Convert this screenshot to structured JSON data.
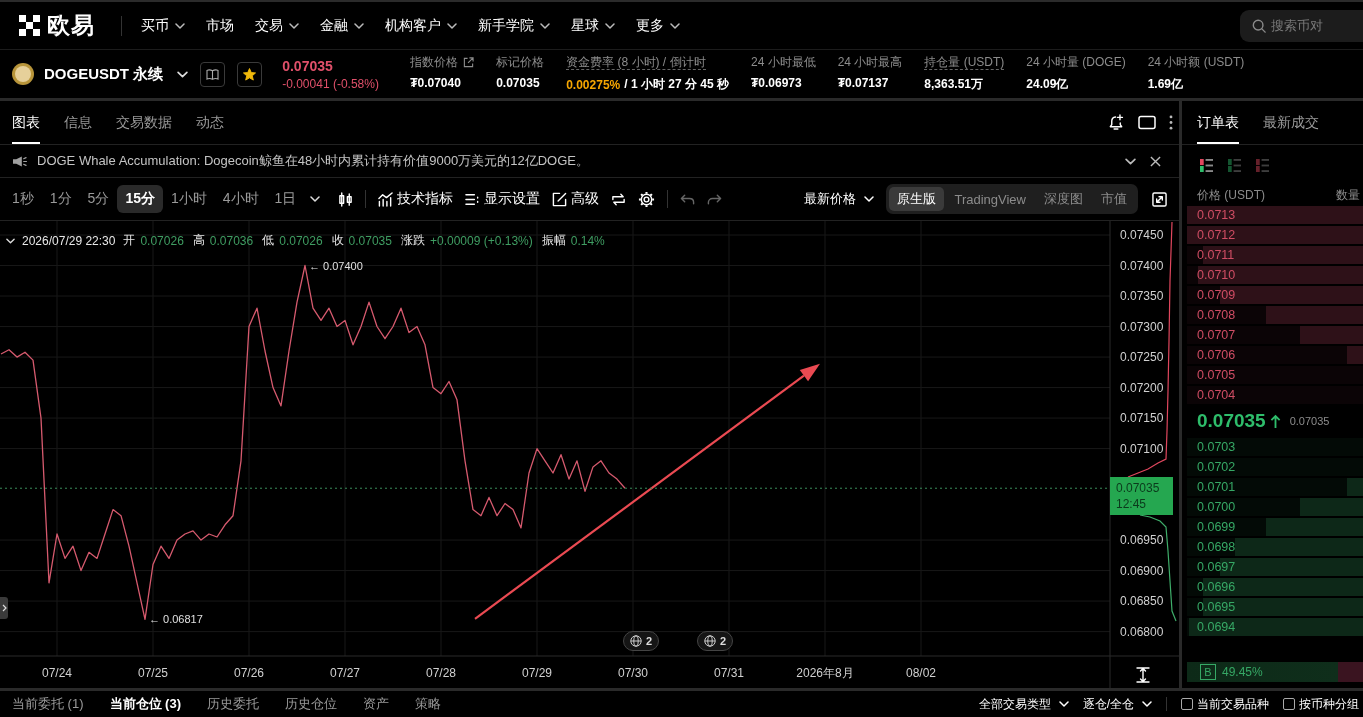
{
  "nav": {
    "logo": "欧易",
    "menu": [
      {
        "label": "买币",
        "dropdown": true
      },
      {
        "label": "市场",
        "dropdown": false
      },
      {
        "label": "交易",
        "dropdown": true
      },
      {
        "label": "金融",
        "dropdown": true
      },
      {
        "label": "机构客户",
        "dropdown": true
      },
      {
        "label": "新手学院",
        "dropdown": true
      },
      {
        "label": "星球",
        "dropdown": true
      },
      {
        "label": "更多",
        "dropdown": true
      }
    ],
    "search": {
      "placeholder": "搜索币对"
    }
  },
  "ticker": {
    "symbol": "DOGEUSDT 永续",
    "favorite": true,
    "price": "0.07035",
    "change": "-0.00041 (-0.58%)",
    "negative": true,
    "stats": [
      {
        "label": "指数价格",
        "kind": "link",
        "value": "₮0.07040"
      },
      {
        "label": "标记价格",
        "kind": "plain",
        "value": "0.07035"
      },
      {
        "label": "资金费率 (8 小时) / 倒计时",
        "kind": "dotted",
        "rate": "0.00275%",
        "value": "/ 1 小时 27 分 45 秒"
      },
      {
        "label": "24 小时最低",
        "kind": "plain",
        "value": "₮0.06973"
      },
      {
        "label": "24 小时最高",
        "kind": "plain",
        "value": "₮0.07137"
      },
      {
        "label": "持仓量 (USDT)",
        "kind": "dotted",
        "value": "8,363.51万"
      },
      {
        "label": "24 小时量 (DOGE)",
        "kind": "plain",
        "value": "24.09亿"
      },
      {
        "label": "24 小时额 (USDT)",
        "kind": "plain",
        "value": "1.69亿"
      }
    ]
  },
  "chart_panel": {
    "tabs": [
      {
        "label": "图表",
        "selected": true
      },
      {
        "label": "信息",
        "selected": false
      },
      {
        "label": "交易数据",
        "selected": false
      },
      {
        "label": "动态",
        "selected": false
      }
    ],
    "news": {
      "text": "DOGE Whale Accumulation: Dogecoin鲸鱼在48小时内累计持有价值9000万美元的12亿DOGE。"
    },
    "intervals": [
      {
        "label": "1秒",
        "selected": false
      },
      {
        "label": "1分",
        "selected": false
      },
      {
        "label": "5分",
        "selected": false
      },
      {
        "label": "15分",
        "selected": true
      },
      {
        "label": "1小时",
        "selected": false
      },
      {
        "label": "4小时",
        "selected": false
      },
      {
        "label": "1日",
        "selected": false
      }
    ],
    "tools": [
      {
        "kind": "indicators",
        "label": "技术指标"
      },
      {
        "kind": "display",
        "label": "显示设置"
      },
      {
        "kind": "advanced",
        "label": "高级"
      }
    ],
    "price_source": {
      "label": "最新价格"
    },
    "views": [
      {
        "label": "原生版",
        "selected": true
      },
      {
        "label": "TradingView",
        "selected": false
      },
      {
        "label": "深度图",
        "selected": false
      },
      {
        "label": "市值",
        "selected": false
      }
    ],
    "legend": {
      "time": "2026/07/29 22:30",
      "fields": [
        {
          "label": "开",
          "value": "0.07026"
        },
        {
          "label": "高",
          "value": "0.07036"
        },
        {
          "label": "低",
          "value": "0.07026"
        },
        {
          "label": "收",
          "value": "0.07035"
        },
        {
          "label": "涨跌",
          "value": "+0.00009 (+0.13%)"
        },
        {
          "label": "振幅",
          "value": "0.14%"
        }
      ]
    },
    "price_tag": {
      "countdown": "12:45"
    },
    "events": [
      {
        "count": "2"
      },
      {
        "count": "2"
      }
    ],
    "chart_data": {
      "type": "line",
      "grid": true,
      "categories": [
        null,
        null,
        null,
        null,
        null,
        null,
        null,
        "07/24",
        null,
        null,
        null,
        null,
        null,
        null,
        null,
        null,
        null,
        null,
        null,
        "07/25",
        null,
        null,
        null,
        null,
        null,
        null,
        null,
        null,
        null,
        null,
        null,
        "07/26",
        null,
        null,
        null,
        null,
        null,
        null,
        null,
        null,
        null,
        null,
        null,
        "07/27",
        null,
        null,
        null,
        null,
        null,
        null,
        null,
        null,
        null,
        null,
        null,
        "07/28",
        null,
        null,
        null,
        null,
        null,
        null,
        null,
        null,
        null,
        null,
        null,
        "07/29",
        null,
        null,
        null,
        null,
        null,
        null,
        null,
        null,
        null,
        null,
        null,
        "07/30",
        null,
        null,
        null,
        null,
        null,
        null,
        null,
        null,
        null,
        null,
        null,
        "07/31",
        null,
        null,
        null,
        null,
        null,
        null,
        null,
        null,
        null,
        null,
        null,
        "2026年8月",
        null,
        null,
        null,
        null,
        null,
        null,
        null,
        null,
        null,
        null,
        null,
        "08/02",
        null,
        null,
        null,
        null,
        null,
        null,
        null,
        null,
        null,
        null,
        null,
        null,
        null,
        null,
        null,
        null,
        null,
        null,
        null,
        null,
        null,
        null,
        null
      ],
      "series": [
        {
          "color": "#d65a6e",
          "values": [
            0.07255,
            0.07262,
            0.0725,
            0.07258,
            0.07245,
            0.0715,
            0.0688,
            0.0696,
            0.0692,
            0.0694,
            0.069,
            0.0693,
            0.0692,
            0.0696,
            0.07,
            0.0699,
            0.0694,
            0.0688,
            0.0682,
            0.0691,
            0.0694,
            0.0692,
            0.0695,
            0.0696,
            0.06965,
            0.0695,
            0.0696,
            0.06955,
            0.06975,
            0.0699,
            0.0708,
            0.073,
            0.0733,
            0.0726,
            0.072,
            0.0717,
            0.0726,
            0.0734,
            0.074,
            0.0733,
            0.0731,
            0.0733,
            0.073,
            0.0731,
            0.0727,
            0.073,
            0.0734,
            0.073,
            0.0728,
            0.073,
            0.0733,
            0.0729,
            0.073,
            0.0727,
            0.072,
            0.0719,
            0.0721,
            0.0718,
            0.0708,
            0.07,
            0.0699,
            0.0702,
            0.0699,
            0.0701,
            0.07,
            0.0697,
            0.0706,
            0.071,
            0.0708,
            0.0706,
            0.0709,
            0.0705,
            0.0708,
            0.0703,
            0.0707,
            0.0708,
            0.0706,
            0.0705,
            0.07035,
            null,
            null,
            null,
            null,
            null,
            null,
            null,
            null,
            null,
            null,
            null,
            null,
            null,
            null,
            null,
            null,
            null,
            null,
            null,
            null,
            null,
            null,
            null,
            null,
            null,
            null,
            null,
            null,
            null,
            null,
            null,
            null,
            null,
            null,
            null,
            null,
            null,
            null,
            null,
            null,
            null,
            null,
            null,
            null,
            null,
            null,
            null,
            null,
            null,
            null,
            null,
            null,
            null,
            null,
            null,
            null,
            null,
            null,
            null,
            null
          ]
        }
      ],
      "ylim": [
        0.0676,
        0.07473
      ],
      "yticks": [
        {
          "value": 0.068,
          "label": "0.06800"
        },
        {
          "value": 0.0685,
          "label": "0.06850"
        },
        {
          "value": 0.069,
          "label": "0.06900"
        },
        {
          "value": 0.0695,
          "label": "0.06950"
        },
        {
          "value": 0.071,
          "label": "0.07100"
        },
        {
          "value": 0.0715,
          "label": "0.07150"
        },
        {
          "value": 0.072,
          "label": "0.07200"
        },
        {
          "value": 0.0725,
          "label": "0.07250"
        },
        {
          "value": 0.073,
          "label": "0.07300"
        },
        {
          "value": 0.0735,
          "label": "0.07350"
        },
        {
          "value": 0.074,
          "label": "0.07400"
        },
        {
          "value": 0.0745,
          "label": "0.07450"
        }
      ],
      "ref_lines": [
        {
          "axis": "y",
          "value": 0.07035,
          "label": "0.07035"
        }
      ],
      "annotations": [
        "← 0.07400",
        "← 0.06817"
      ]
    }
  },
  "order_book": {
    "tabs": [
      {
        "label": "订单表",
        "selected": true
      },
      {
        "label": "最新成交",
        "selected": false
      }
    ],
    "layouts": [
      {
        "kind": "both",
        "selected": true
      },
      {
        "kind": "bids",
        "selected": false
      },
      {
        "kind": "asks",
        "selected": false
      }
    ],
    "columns": [
      "价格 (USDT)",
      "数量"
    ],
    "asks": [
      {
        "price": "0.0713",
        "level": 1
      },
      {
        "price": "0.0712",
        "level": 1
      },
      {
        "price": "0.0711",
        "level": 0.91
      },
      {
        "price": "0.0710",
        "level": 0.94
      },
      {
        "price": "0.0709",
        "level": 0.81
      },
      {
        "price": "0.0708",
        "level": 0.55
      },
      {
        "price": "0.0707",
        "level": 0.36
      },
      {
        "price": "0.0706",
        "level": 0.09
      },
      {
        "price": "0.0705"
      },
      {
        "price": "0.0704"
      }
    ],
    "last_price": "0.07035",
    "rising": true,
    "mark_price": "0.07035",
    "bids": [
      {
        "price": "0.0703"
      },
      {
        "price": "0.0702"
      },
      {
        "price": "0.0701",
        "level": 0.09
      },
      {
        "price": "0.0700",
        "level": 0.36
      },
      {
        "price": "0.0699",
        "level": 0.55
      },
      {
        "price": "0.0698",
        "level": 0.73
      },
      {
        "price": "0.0697",
        "level": 0.81
      },
      {
        "price": "0.0696",
        "level": 0.91
      },
      {
        "price": "0.0695",
        "level": 0.91
      },
      {
        "price": "0.0694",
        "level": 0.99
      }
    ],
    "ratio": {
      "side": "B",
      "value": "49.45%"
    }
  },
  "bottom_panel": {
    "tabs": [
      {
        "label": "当前委托 (1)",
        "selected": false
      },
      {
        "label": "当前仓位 (3)",
        "selected": true
      },
      {
        "label": "历史委托",
        "selected": false
      },
      {
        "label": "历史仓位",
        "selected": false
      },
      {
        "label": "资产",
        "selected": false
      },
      {
        "label": "策略",
        "selected": false
      }
    ],
    "filters": [
      {
        "label": "全部交易类型"
      },
      {
        "label": "逐仓/全仓"
      }
    ],
    "checkboxes": [
      {
        "label": "当前交易品种",
        "checked": false
      },
      {
        "label": "按币种分组",
        "checked": false
      }
    ]
  }
}
